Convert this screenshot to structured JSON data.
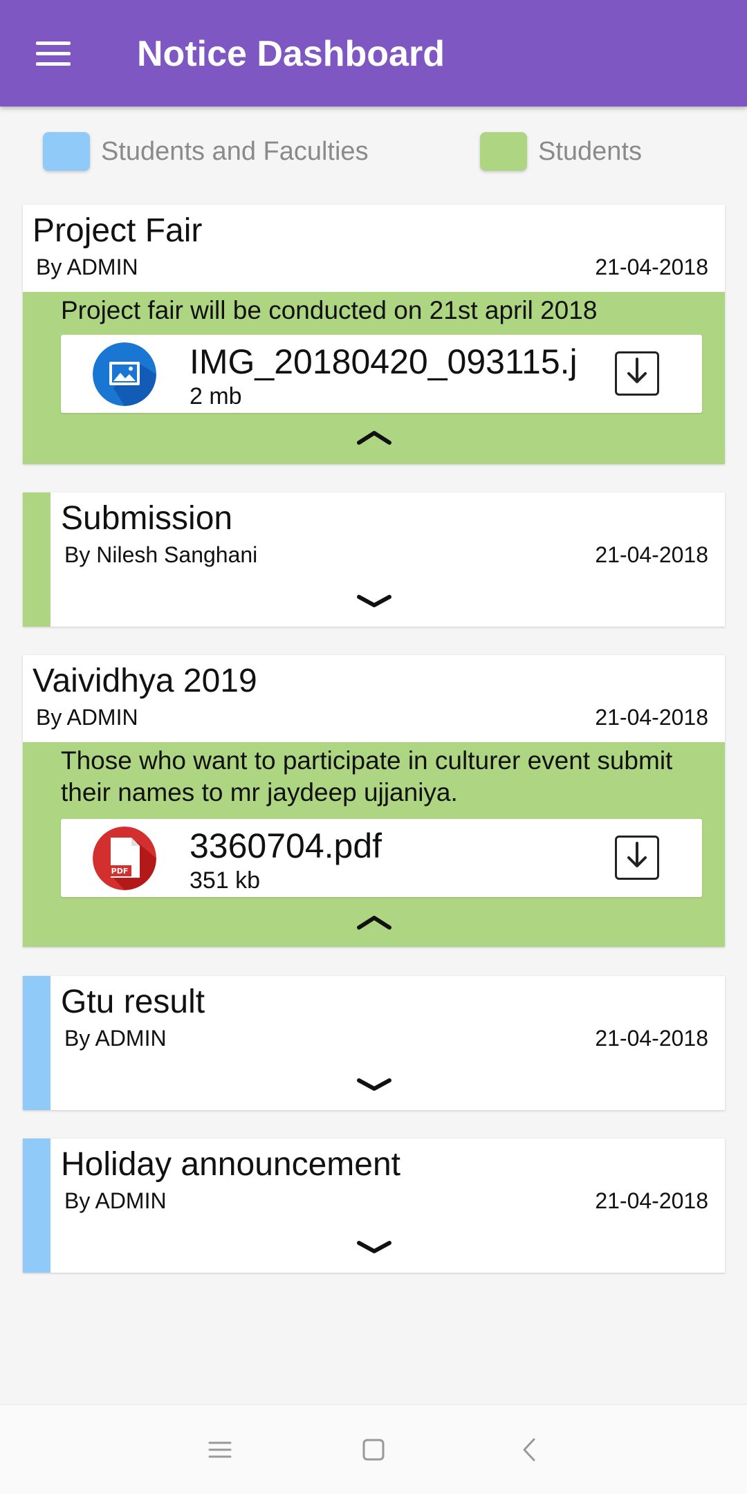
{
  "app": {
    "title": "Notice Dashboard"
  },
  "colors": {
    "appbar": "#7e57c2",
    "faculty_blue": "#90caf9",
    "student_green": "#aed581",
    "pdf_red": "#c62828",
    "image_blue": "#1565c0"
  },
  "legend": [
    {
      "label": "Students and Faculties",
      "color": "#90caf9"
    },
    {
      "label": "Students",
      "color": "#aed581"
    }
  ],
  "notices": [
    {
      "title": "Project Fair",
      "author": "By ADMIN",
      "date": "21-04-2018",
      "expanded": true,
      "audience": "Students",
      "description": "Project fair will be conducted on 21st april 2018",
      "attachment": {
        "name": "IMG_20180420_093115.j",
        "size": "2 mb",
        "icon": "image-file-icon"
      }
    },
    {
      "title": "Submission",
      "author": "By Nilesh Sanghani",
      "date": "21-04-2018",
      "expanded": false,
      "audience": "Students"
    },
    {
      "title": "Vaividhya 2019",
      "author": "By ADMIN",
      "date": "21-04-2018",
      "expanded": true,
      "audience": "Students",
      "description": "Those who want to participate in culturer event submit their names to mr jaydeep ujjaniya.",
      "attachment": {
        "name": "3360704.pdf",
        "size": "351 kb",
        "icon": "pdf-file-icon",
        "badge": "PDF"
      }
    },
    {
      "title": "Gtu result",
      "author": "By ADMIN",
      "date": "21-04-2018",
      "expanded": false,
      "audience": "Students and Faculties"
    },
    {
      "title": "Holiday announcement",
      "author": "By ADMIN",
      "date": "21-04-2018",
      "expanded": false,
      "audience": "Students and Faculties"
    }
  ],
  "system_nav": [
    "recents-icon",
    "home-icon",
    "back-icon"
  ]
}
